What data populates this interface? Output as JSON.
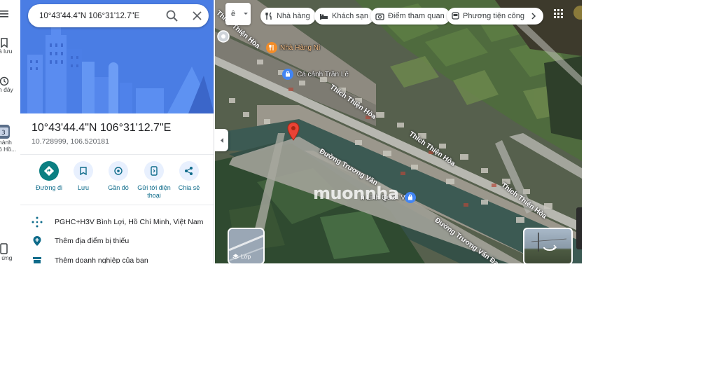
{
  "search": {
    "value": "10°43'44.4\"N 106°31'12.7\"E"
  },
  "rail": {
    "items": [
      {
        "label": "à lưu",
        "icon": "bookmark-icon"
      },
      {
        "label": "n đây",
        "icon": "history-icon"
      },
      {
        "label": "hành",
        "label2": "ồ Hồ...",
        "icon": "app-thumbnail-icon"
      },
      {
        "label": "i ứng",
        "icon": "phone-icon"
      }
    ]
  },
  "place": {
    "title": "10°43'44.4\"N 106°31'12.7\"E",
    "coords": "10.728999, 106.520181"
  },
  "actions": [
    {
      "label": "Đường đi",
      "icon": "directions-icon"
    },
    {
      "label": "Lưu",
      "icon": "bookmark-icon"
    },
    {
      "label": "Gần đó",
      "icon": "nearby-icon"
    },
    {
      "label": "Gửi tới điện",
      "label2": "thoại",
      "icon": "send-to-phone-icon"
    },
    {
      "label": "Chia sẻ",
      "icon": "share-icon"
    }
  ],
  "info": {
    "plus_code": "PGHC+H3V Bình Lợi, Hồ Chí Minh, Việt Nam",
    "add_place": "Thêm địa điểm bị thiếu",
    "add_business": "Thêm doanh nghiệp của bạn"
  },
  "map": {
    "lang_button": "ê",
    "chips": [
      {
        "label": "Nhà hàng",
        "icon": "restaurant-icon"
      },
      {
        "label": "Khách sạn",
        "icon": "hotel-icon"
      },
      {
        "label": "Điểm tham quan",
        "icon": "camera-icon"
      },
      {
        "label": "Phương tiện công",
        "icon": "transit-icon"
      }
    ],
    "places": {
      "restaurant": "Nhà Hàng Ni",
      "store": "Cá cảnh Trần Lê",
      "lower_place": "n Linh Quân Võ"
    },
    "roads": {
      "r1": "Thích Thiện Hòa",
      "r2": "Thích Thiện Hòa",
      "r3": "Thích Thiện Hòa",
      "r4": "Thích Thiện Hòa",
      "r5": "Đường Trương Văn",
      "r6": "Đường Trương Văn Đa"
    },
    "layer_label": "Lớp",
    "watermark": "muonnha",
    "pin_color": "#ea4335"
  }
}
